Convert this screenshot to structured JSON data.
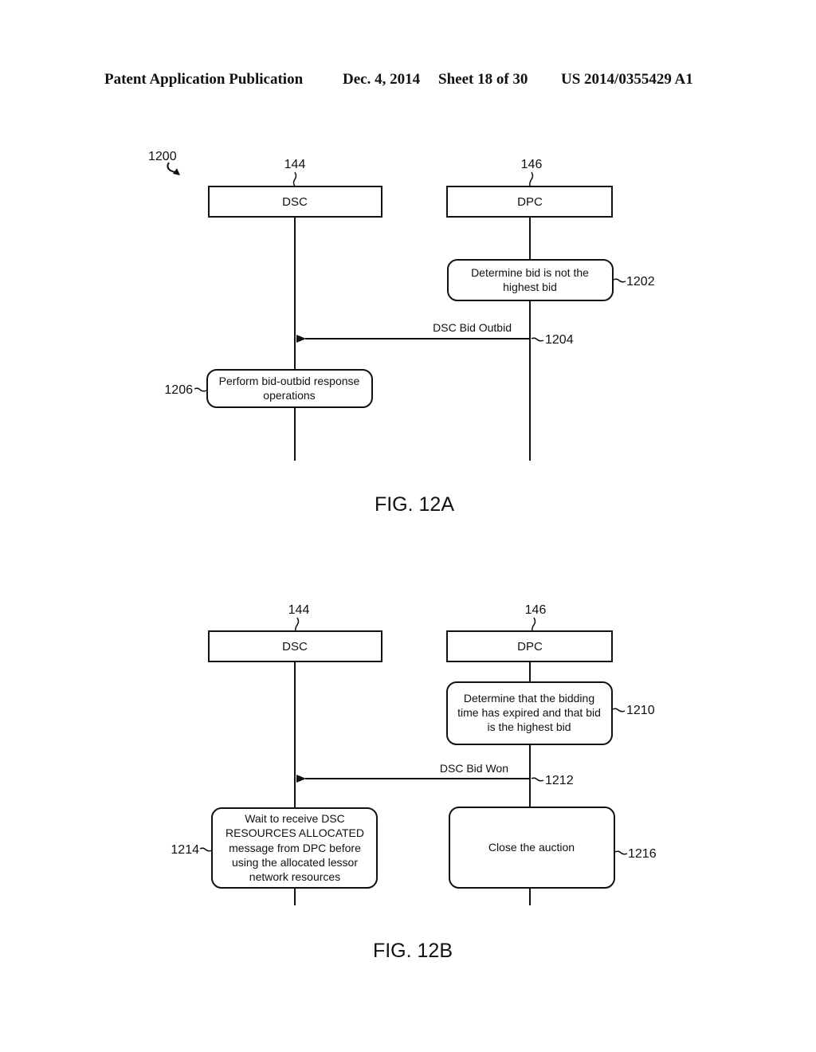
{
  "header": {
    "publication": "Patent Application Publication",
    "date": "Dec. 4, 2014",
    "sheet": "Sheet 18 of 30",
    "number": "US 2014/0355429 A1"
  },
  "fig12a": {
    "ref": "1200",
    "caption": "FIG. 12A",
    "lifelines": [
      {
        "ref": "144",
        "label": "DSC"
      },
      {
        "ref": "146",
        "label": "DPC"
      }
    ],
    "steps": [
      {
        "ref": "1202",
        "lines": [
          "Determine bid is not the",
          "highest bid"
        ]
      },
      {
        "ref": "1204",
        "message": "DSC Bid Outbid"
      },
      {
        "ref": "1206",
        "lines": [
          "Perform bid-outbid response",
          "operations"
        ]
      }
    ]
  },
  "fig12b": {
    "caption": "FIG. 12B",
    "lifelines": [
      {
        "ref": "144",
        "label": "DSC"
      },
      {
        "ref": "146",
        "label": "DPC"
      }
    ],
    "steps": [
      {
        "ref": "1210",
        "lines": [
          "Determine that the bidding",
          "time has expired and that bid",
          "is the highest bid"
        ]
      },
      {
        "ref": "1212",
        "message": "DSC Bid Won"
      },
      {
        "ref": "1214",
        "lines": [
          "Wait to receive DSC",
          "RESOURCES ALLOCATED",
          "message from DPC before",
          "using the allocated lessor",
          "network resources"
        ]
      },
      {
        "ref": "1216",
        "lines": [
          "Close the auction"
        ]
      }
    ]
  }
}
